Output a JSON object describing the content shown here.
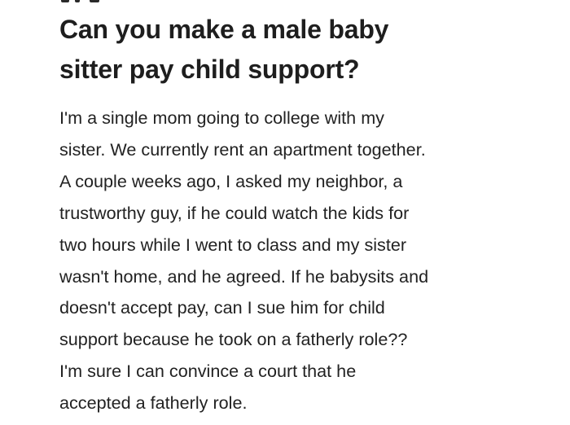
{
  "post": {
    "title_lines": [
      "Can you make a male baby",
      "sitter pay child support?"
    ],
    "body_lines": [
      "I'm a single mom going to college with my",
      "sister. We currently rent an apartment together.",
      "A couple weeks ago, I asked my neighbor, a",
      "trustworthy guy, if he could watch the kids for",
      "two hours while I went to class and my sister",
      "wasn't home, and he agreed. If he babysits and",
      "doesn't accept pay, can I sue him for child",
      "support because he took on a fatherly role??",
      "I'm sure I can convince a court that he",
      "accepted a fatherly role."
    ]
  }
}
